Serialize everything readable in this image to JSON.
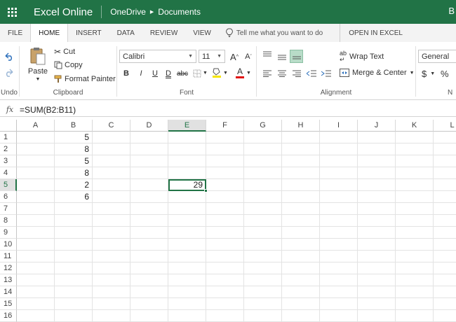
{
  "titlebar": {
    "app_title": "Excel Online",
    "breadcrumb_root": "OneDrive",
    "breadcrumb_folder": "Documents",
    "user_initial": "B",
    "bg_color": "#217346"
  },
  "tabs": {
    "file": "FILE",
    "home": "HOME",
    "insert": "INSERT",
    "data": "DATA",
    "review": "REVIEW",
    "view": "VIEW",
    "tell_me": "Tell me what you want to do",
    "open_in_excel": "OPEN IN EXCEL"
  },
  "ribbon": {
    "undo_label": "Undo",
    "paste_label": "Paste",
    "cut_label": "Cut",
    "copy_label": "Copy",
    "format_painter_label": "Format Painter",
    "clipboard_group": "Clipboard",
    "font_name": "Calibri",
    "font_size": "11",
    "bold": "B",
    "italic": "I",
    "underline": "U",
    "double_underline": "D",
    "strikethrough": "abc",
    "font_group": "Font",
    "wrap_text_label": "Wrap Text",
    "merge_center_label": "Merge & Center",
    "alignment_group": "Alignment",
    "number_format": "General",
    "currency_symbol": "$",
    "percent_symbol": "%",
    "number_group_partial": "N"
  },
  "formula_bar": {
    "fx_label": "fx",
    "formula": "=SUM(B2:B11)"
  },
  "sheet": {
    "columns": [
      "A",
      "B",
      "C",
      "D",
      "E",
      "F",
      "G",
      "H",
      "I",
      "J",
      "K",
      "L"
    ],
    "rows": [
      "1",
      "2",
      "3",
      "4",
      "5",
      "6",
      "7",
      "8",
      "9",
      "10",
      "11",
      "12",
      "13",
      "14",
      "15",
      "16"
    ],
    "selected_column": "E",
    "selected_row": "5",
    "cells": [
      {
        "ref": "B1",
        "value": "5"
      },
      {
        "ref": "B2",
        "value": "8"
      },
      {
        "ref": "B3",
        "value": "5"
      },
      {
        "ref": "B4",
        "value": "8"
      },
      {
        "ref": "B5",
        "value": "2"
      },
      {
        "ref": "B6",
        "value": "6"
      },
      {
        "ref": "E5",
        "value": "29"
      }
    ],
    "active_cell": "E5",
    "accent_color": "#217346"
  }
}
